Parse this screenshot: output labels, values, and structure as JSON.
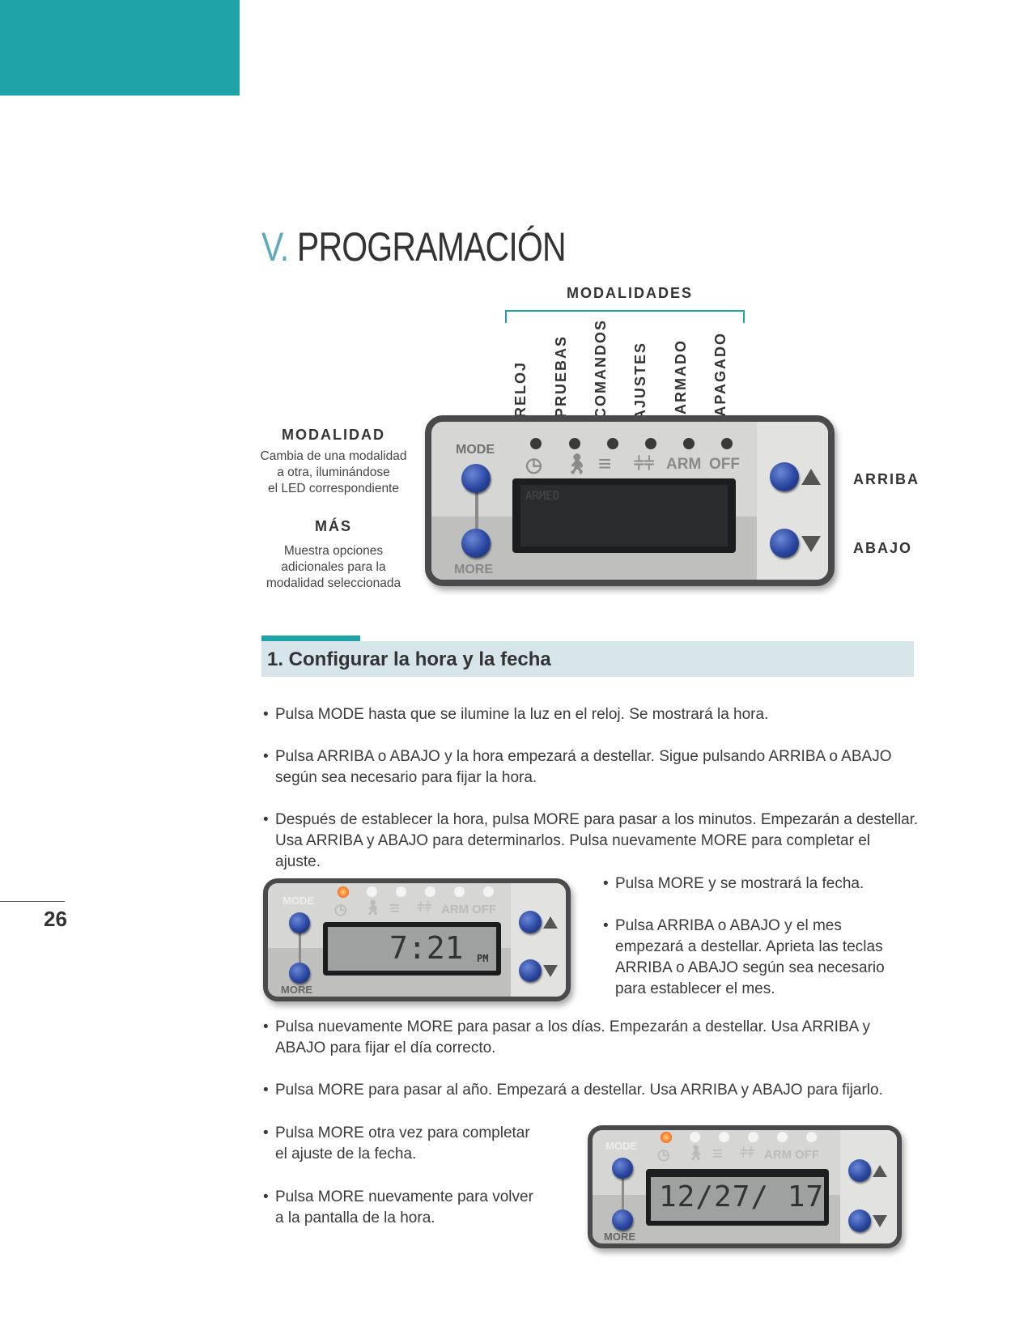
{
  "page": {
    "number": "26"
  },
  "title": {
    "num": "V.",
    "text": "PROGRAMACIÓN"
  },
  "modalidades": {
    "heading": "MODALIDADES",
    "labels": [
      "RELOJ",
      "PRUEBAS",
      "COMANDOS",
      "AJUSTES",
      "ARMADO",
      "APAGADO"
    ]
  },
  "left_notes": {
    "modalidad_heading": "MODALIDAD",
    "modalidad_text": [
      "Cambia de una modalidad",
      "a otra, iluminándose",
      "el LED correspondiente"
    ],
    "mas_heading": "MÁS",
    "mas_text": [
      "Muestra opciones",
      "adicionales para la",
      "modalidad seleccionada"
    ]
  },
  "right_notes": {
    "arriba": "ARRIBA",
    "abajo": "ABAJO"
  },
  "panel": {
    "mode": "MODE",
    "more": "MORE",
    "arm": "ARM",
    "off": "OFF",
    "main_display": "ARMED",
    "time_display": "7:21",
    "time_suffix": "PM",
    "date_display": "12/27/ 17",
    "icons": [
      "clock-icon",
      "walking-person-icon",
      "bars-icon",
      "sliders-icon"
    ]
  },
  "section": {
    "title": "1. Configurar la hora y la fecha",
    "bullets": [
      [
        "Pulsa MODE hasta que se ilumine la luz en el reloj. Se mostrará la hora."
      ],
      [
        "Pulsa ARRIBA o ABAJO y la hora empezará a destellar. Sigue pulsando ARRIBA o ABAJO",
        "según sea necesario para fijar la hora."
      ],
      [
        "Después de establecer la hora, pulsa MORE para pasar a los minutos. Empezarán a destellar.",
        "Usa ARRIBA y ABAJO para determinarlos. Pulsa nuevamente MORE para completar el ajuste."
      ],
      [
        "Pulsa MORE y se mostrará la fecha."
      ],
      [
        "Pulsa ARRIBA o ABAJO y el mes",
        "empezará a destellar. Aprieta las teclas",
        "ARRIBA o ABAJO según sea necesario",
        "para establecer el mes."
      ],
      [
        "Pulsa nuevamente MORE para pasar a los días. Empezarán a destellar. Usa ARRIBA y",
        "ABAJO para fijar el día correcto."
      ],
      [
        "Pulsa MORE para pasar al año. Empezará a destellar. Usa ARRIBA y ABAJO para fijarlo."
      ],
      [
        "Pulsa MORE otra vez para completar",
        "el ajuste de la fecha."
      ],
      [
        "Pulsa MORE nuevamente para volver",
        "a la pantalla de la hora."
      ]
    ]
  },
  "colors": {
    "teal": "#1fa3a8",
    "section_bg": "#d6e5ea",
    "title_num": "#5fa9bc"
  }
}
